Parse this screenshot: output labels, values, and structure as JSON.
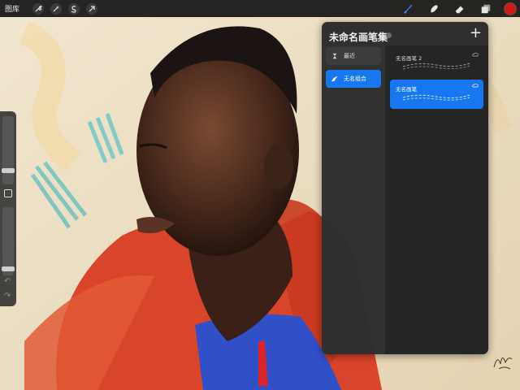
{
  "toolbar": {
    "gallery_label": "图库",
    "left_tools": [
      {
        "icon": "wrench-icon"
      },
      {
        "icon": "magic-wand-icon"
      },
      {
        "icon": "selection-icon"
      },
      {
        "icon": "transform-arrow-icon"
      }
    ],
    "right_tools": [
      {
        "icon": "brush-icon",
        "active": true
      },
      {
        "icon": "smudge-icon"
      },
      {
        "icon": "eraser-icon"
      },
      {
        "icon": "layers-icon"
      }
    ],
    "current_color": "#d01a18",
    "active_tool_color": "#2f8cff"
  },
  "sidebar": {
    "size_slider_fraction": 0.18,
    "opacity_slider_fraction": 0.07,
    "modify_icon": "square-icon",
    "undo_icon": "undo-icon",
    "redo_icon": "redo-icon"
  },
  "brush_library": {
    "title": "未命名画笔集",
    "add_icon": "+",
    "brush_sets": [
      {
        "label": "最近",
        "icon": "hourglass-icon",
        "active": false
      },
      {
        "label": "无名组合",
        "icon": "brush-stroke-icon",
        "active": true
      }
    ],
    "brushes": [
      {
        "name": "无名画笔 2",
        "icon": "cloud-icon",
        "selected": false
      },
      {
        "name": "无名画笔",
        "icon": "cloud-icon",
        "selected": true
      }
    ],
    "accent_color": "#1677f0"
  }
}
